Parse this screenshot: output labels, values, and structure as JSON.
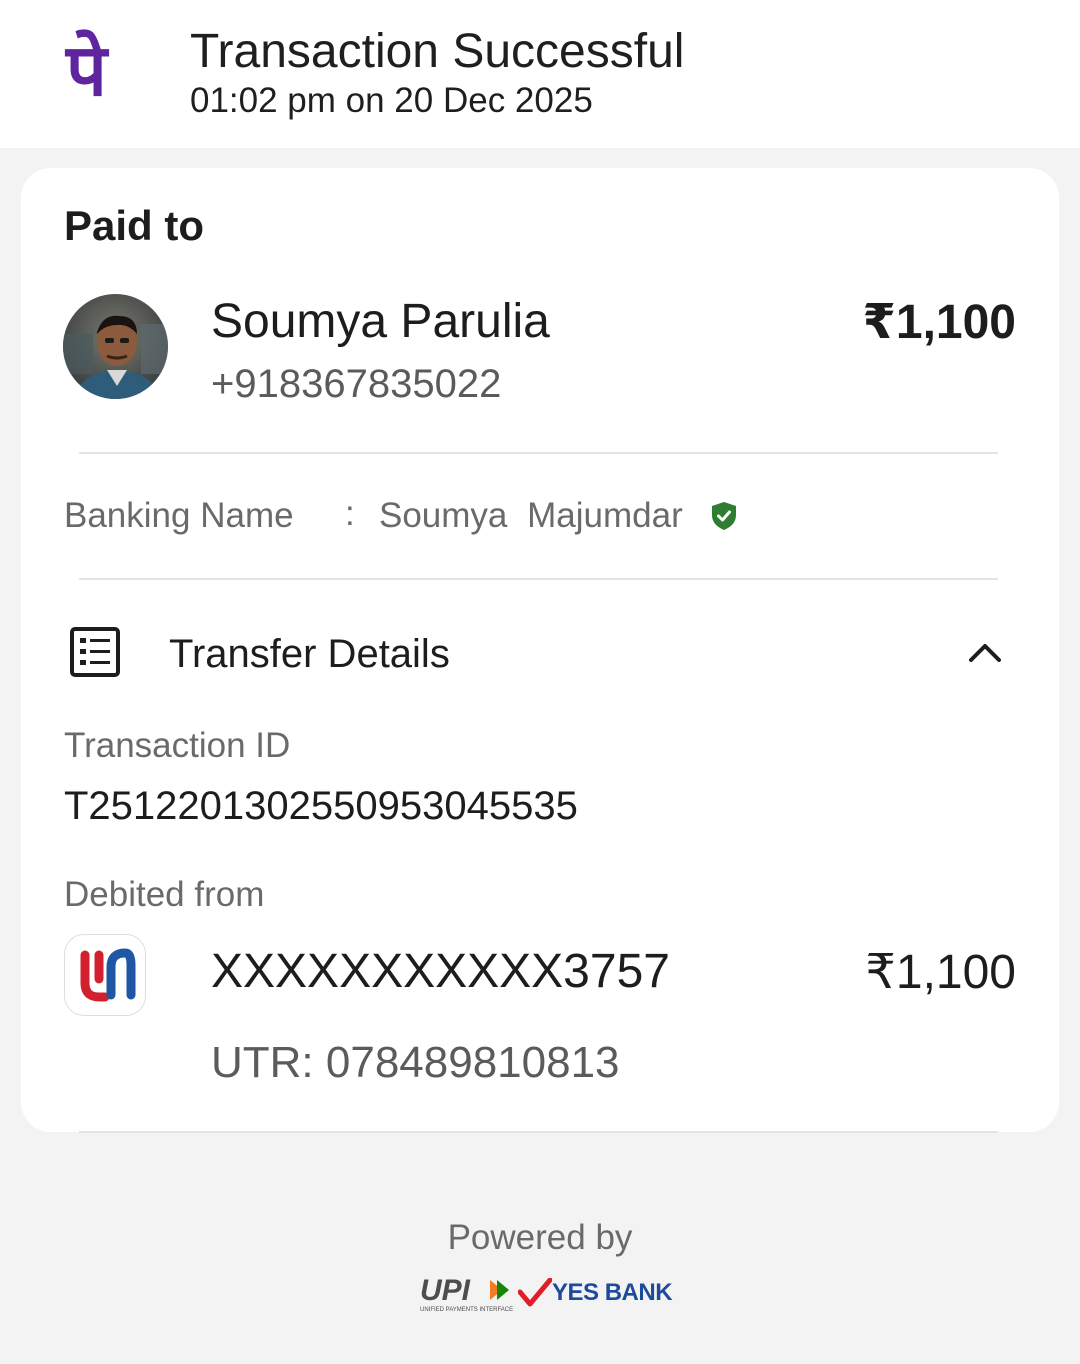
{
  "header": {
    "logo_glyph": "पे",
    "title": "Transaction Successful",
    "subtitle": "01:02 pm on 20 Dec 2025"
  },
  "paid_to": {
    "label": "Paid to",
    "name": "Soumya Parulia",
    "phone": "+918367835022",
    "amount": "₹1,100"
  },
  "banking": {
    "label": "Banking Name",
    "separator": ":",
    "value": "Soumya  Majumdar",
    "verified_icon": "verified-shield-icon"
  },
  "transfer_details": {
    "title": "Transfer Details",
    "icon": "receipt-list-icon",
    "toggle_icon": "chevron-up-icon",
    "transaction_id_label": "Transaction ID",
    "transaction_id": "T2512201302550953045535",
    "debited_from_label": "Debited from",
    "account_number": "XXXXXXXXXXX3757",
    "debit_amount": "₹1,100",
    "utr": "UTR: 078489810813"
  },
  "footer": {
    "powered_by": "Powered by",
    "upi_logo_text": "UPI",
    "upi_tagline": "UNIFIED PAYMENTS INTERFACE",
    "partner_bank": "YES BANK"
  },
  "colors": {
    "brand": "#5f259f",
    "verified": "#2e7d32",
    "bank_logo_red": "#d3202f",
    "bank_logo_blue": "#2057a5"
  }
}
